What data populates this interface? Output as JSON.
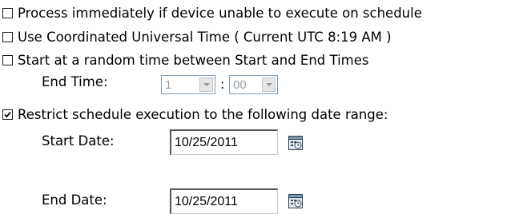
{
  "options": {
    "process_immediately": {
      "label": "Process immediately if device unable to execute on schedule",
      "checked": false
    },
    "use_utc": {
      "label": "Use Coordinated Universal Time ( Current UTC 8:19 AM )",
      "checked": false
    },
    "random_time": {
      "label": "Start at a random time between Start and End Times",
      "checked": false
    },
    "restrict_date_range": {
      "label": "Restrict schedule execution to the following date range:",
      "checked": true
    }
  },
  "end_time": {
    "label": "End Time:",
    "hour": "1",
    "separator": ":",
    "minute": "00"
  },
  "start_date": {
    "label": "Start Date:",
    "value": "10/25/2011"
  },
  "end_date": {
    "label": "End Date:",
    "value": "10/25/2011"
  },
  "icons": {
    "calendar": "calendar-icon",
    "dropdown": "chevron-down-icon"
  },
  "colors": {
    "disabled_text": "#9c9c9c",
    "input_border": "#7f9db9"
  }
}
